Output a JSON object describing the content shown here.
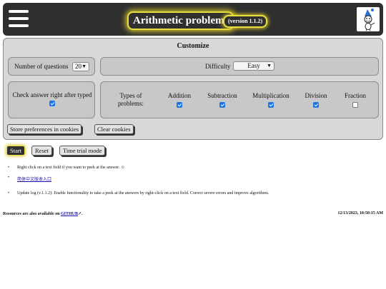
{
  "header": {
    "title": "Arithmetic problems",
    "version": "(version 1.1.2)"
  },
  "customize": {
    "title": "Customize",
    "num_questions_label": "Number of questions",
    "num_questions_value": "20",
    "difficulty_label": "Difficulty",
    "difficulty_value": "Easy",
    "check_answer_label": "Check answer right after typed",
    "check_answer_checked": true,
    "types_label": "Types of problems:",
    "types": [
      {
        "label": "Addition",
        "checked": true
      },
      {
        "label": "Subtraction",
        "checked": true
      },
      {
        "label": "Multiplication",
        "checked": true
      },
      {
        "label": "Division",
        "checked": true
      },
      {
        "label": "Fraction",
        "checked": false
      }
    ],
    "store_button": "Store preferences in cookies",
    "clear_button": "Clear cookies"
  },
  "controls": {
    "start": "Start",
    "reset": "Reset",
    "time_trial": "Time trial mode"
  },
  "notes": {
    "peek": "Right click on a text field if you want to peek at the answer. ☺",
    "chinese_link": "简体中文版本入口",
    "update_log": "Update log (v.1.1.2): Enable functionality to take a peek at the answers by right-click on a text field. Correct severe errors and improve algorithms."
  },
  "footer": {
    "resources_prefix": "Resources are also available on",
    "github": "GITHUB",
    "resources_suffix": ".",
    "datetime": "12/13/2023, 10:50:15 AM"
  },
  "colors": {
    "header_bg": "#2f2f2f",
    "glow": "#e8de3f",
    "panel_bg": "#d8d8d8",
    "checkbox_on": "#1a73e8"
  }
}
